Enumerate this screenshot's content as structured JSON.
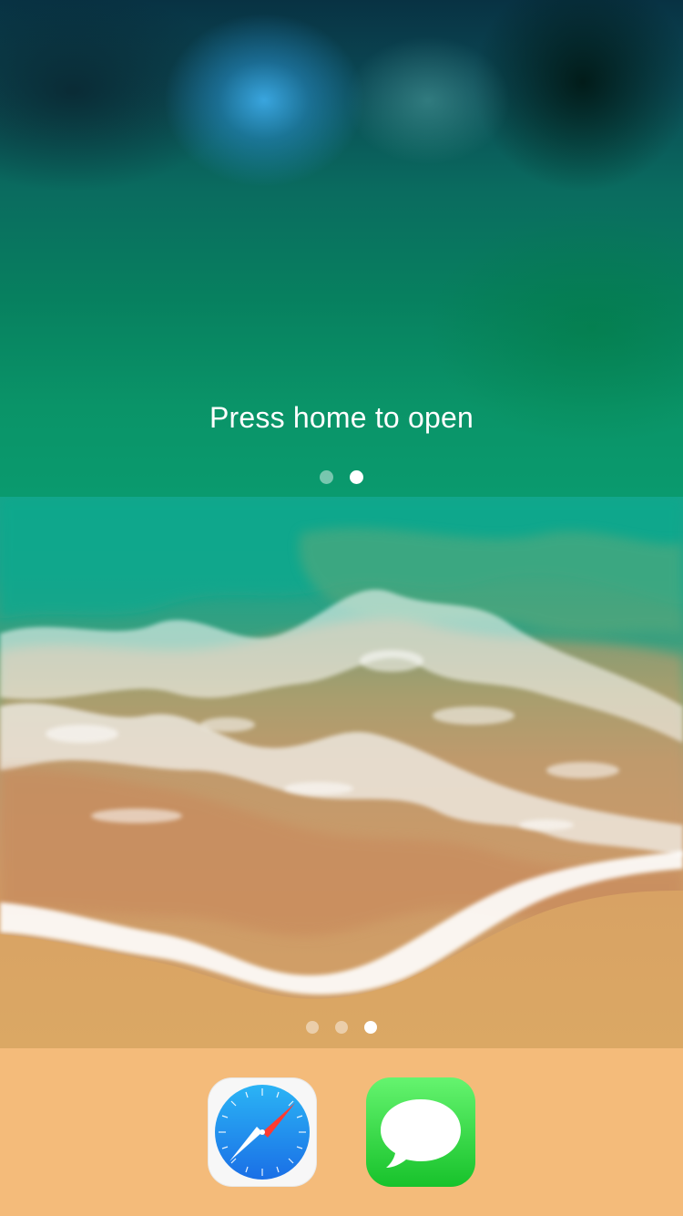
{
  "lock_panel": {
    "message": "Press home to open",
    "page_indicator": {
      "count": 2,
      "active_index": 1
    }
  },
  "home": {
    "page_indicator": {
      "count": 3,
      "active_index": 2
    }
  },
  "dock": {
    "apps": [
      {
        "name": "Safari",
        "icon": "safari-compass-icon"
      },
      {
        "name": "Messages",
        "icon": "speech-bubble-icon"
      }
    ]
  },
  "colors": {
    "dock_background": "#f4bb7a",
    "safari_blue": "#1f8cf0",
    "messages_green": "#17c22b"
  }
}
